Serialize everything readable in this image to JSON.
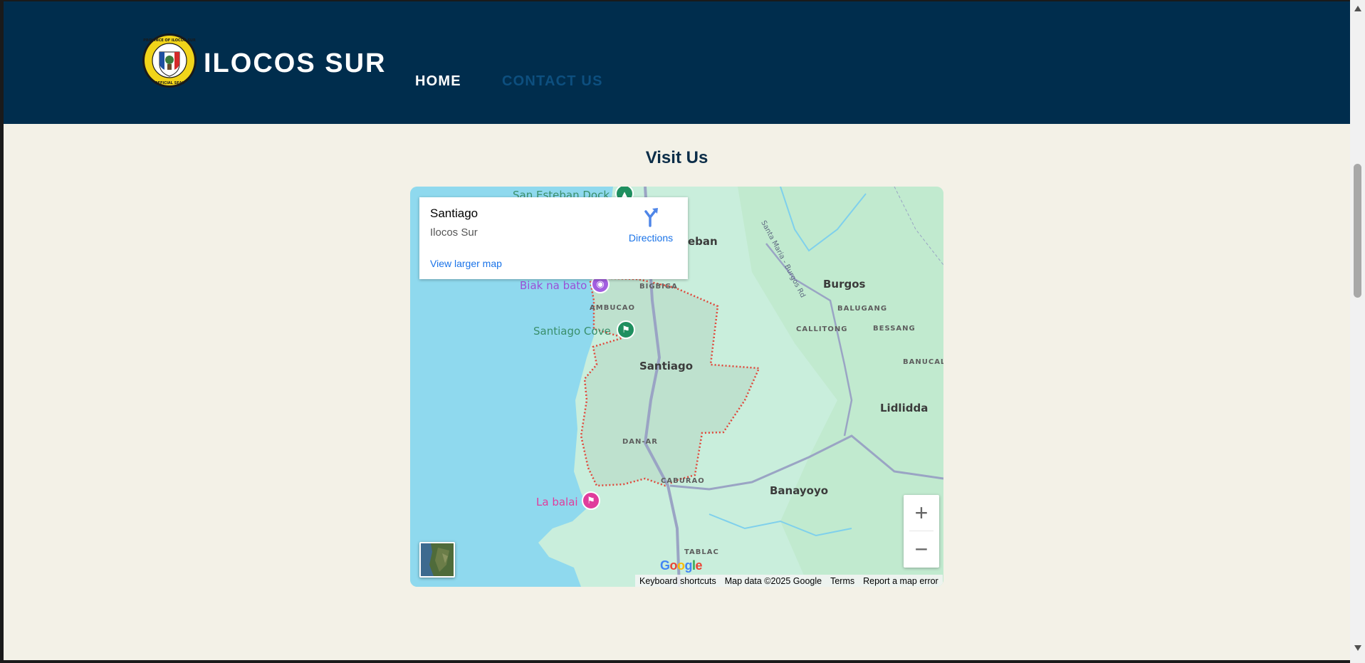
{
  "header": {
    "seal_icon": "province-seal-icon",
    "seal_text": "PROVINCE OF ILOCOS SUR · OFFICIAL SEAL",
    "brand": "ILOCOS SUR",
    "nav": {
      "home": "HOME",
      "contact": "CONTACT US"
    },
    "colors": {
      "background": "#002d4d",
      "active": "#ffffff",
      "inactive": "#0d4f7f"
    }
  },
  "section": {
    "title": "Visit Us"
  },
  "map": {
    "info": {
      "title": "Santiago",
      "subtitle": "Ilocos Sur",
      "directions": "Directions",
      "larger_map": "View larger map"
    },
    "labels": {
      "towns": [
        "Santiago",
        "Burgos",
        "Lidlidda",
        "Banayoyo"
      ],
      "partial_town": "eban",
      "barangays": [
        "BIGBIGA",
        "AMBUCAO",
        "BALUGANG",
        "CALLITONG",
        "BESSANG",
        "BANUCAL",
        "DAN-AR",
        "CABURAO",
        "TABLAC"
      ],
      "road": "Santa Maria - Burgos Rd",
      "pois": [
        "San Esteban Dock",
        "Biak na bato",
        "Santiago Cove",
        "La balai"
      ]
    },
    "controls": {
      "zoom_in": "+",
      "zoom_out": "−"
    },
    "logo": "Google",
    "attribution": [
      "Keyboard shortcuts",
      "Map data ©2025 Google",
      "Terms",
      "Report a map error"
    ],
    "colors": {
      "water": "#8fd9ee",
      "land": "#c9eedc",
      "boundary": "#e0473a",
      "link": "#1a73e8"
    }
  }
}
